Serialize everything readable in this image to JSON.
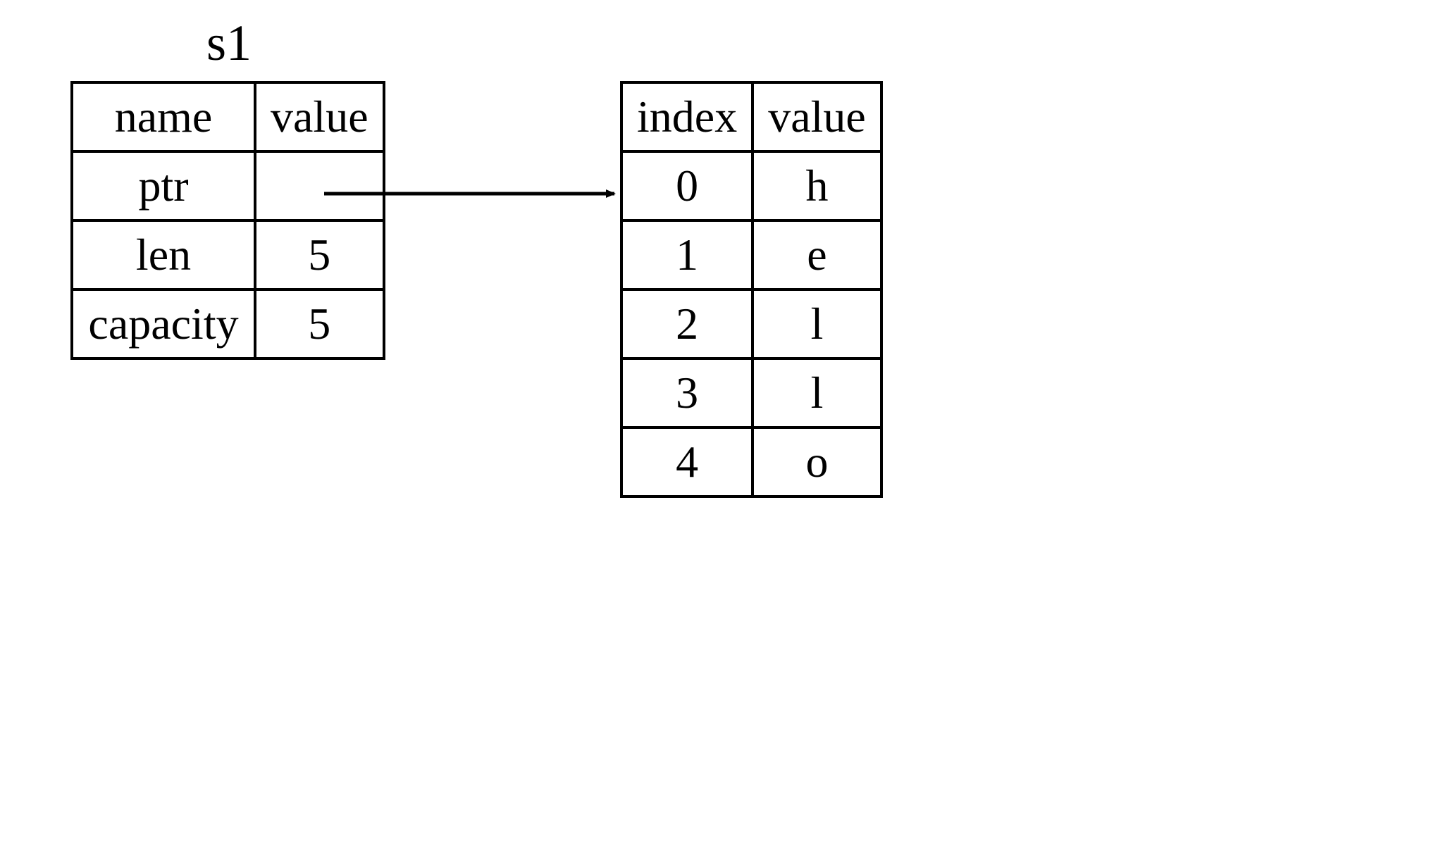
{
  "left_table": {
    "title": "s1",
    "headers": {
      "col1": "name",
      "col2": "value"
    },
    "rows": [
      {
        "name": "ptr",
        "value": ""
      },
      {
        "name": "len",
        "value": "5"
      },
      {
        "name": "capacity",
        "value": "5"
      }
    ]
  },
  "right_table": {
    "headers": {
      "col1": "index",
      "col2": "value"
    },
    "rows": [
      {
        "index": "0",
        "value": "h"
      },
      {
        "index": "1",
        "value": "e"
      },
      {
        "index": "2",
        "value": "l"
      },
      {
        "index": "3",
        "value": "l"
      },
      {
        "index": "4",
        "value": "o"
      }
    ]
  },
  "chart_data": {
    "type": "table",
    "description": "Memory layout of a String struct (s1) with a pointer to heap-allocated character buffer",
    "struct": {
      "name": "s1",
      "fields": [
        {
          "name": "ptr",
          "value": "→ heap buffer"
        },
        {
          "name": "len",
          "value": 5
        },
        {
          "name": "capacity",
          "value": 5
        }
      ]
    },
    "heap_buffer": [
      {
        "index": 0,
        "value": "h"
      },
      {
        "index": 1,
        "value": "e"
      },
      {
        "index": 2,
        "value": "l"
      },
      {
        "index": 3,
        "value": "l"
      },
      {
        "index": 4,
        "value": "o"
      }
    ],
    "arrow": {
      "from": "s1.ptr (value cell)",
      "to": "heap_buffer top-left"
    }
  }
}
